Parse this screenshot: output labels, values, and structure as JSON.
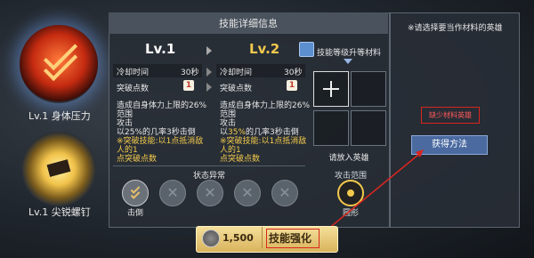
{
  "skills": [
    {
      "label": "Lv.1 身体压力"
    },
    {
      "label": "Lv.1 尖锐螺钉"
    }
  ],
  "panel": {
    "title": "技能详细信息",
    "current_level": "Lv.1",
    "next_level": "Lv.2",
    "cooldown_label": "冷却时间",
    "cooldown_current": "30秒",
    "cooldown_next": "30秒",
    "break_label": "突破点数",
    "break_current": "1",
    "break_next": "1",
    "desc_current": {
      "line1": "造成自身体力上限的26%范围",
      "line2": "攻击",
      "line3": "以25%的几率3秒击倒",
      "line4": "※突破技能:以1点抵消敌人的1",
      "line5": "点突破点数"
    },
    "desc_next": {
      "line1": "造成自身体力上限的26%范围",
      "line2": "攻击",
      "line3_pre": "以",
      "line3_hl": "35%",
      "line3_post": "的几率3秒击倒",
      "line4": "※突破技能:以1点抵消敌人的1",
      "line5": "点突破点数"
    }
  },
  "materials": {
    "title": "技能等级升等材料",
    "add_label": "请放入英雄"
  },
  "status": {
    "title": "状态异常",
    "active_label": "击倒"
  },
  "attack_range": {
    "title": "攻击范围",
    "label": "圆形"
  },
  "right_panel": {
    "hint": "※请选择要当作材料的英雄",
    "lack_text": "缺少材料英雄",
    "get_button": "获得方法"
  },
  "strengthen": {
    "cost": "1,500",
    "label": "技能强化"
  },
  "colors": {
    "accent_yellow": "#f2c94c",
    "warning_red": "#d8261e",
    "button_blue": "#4a6aa0"
  }
}
